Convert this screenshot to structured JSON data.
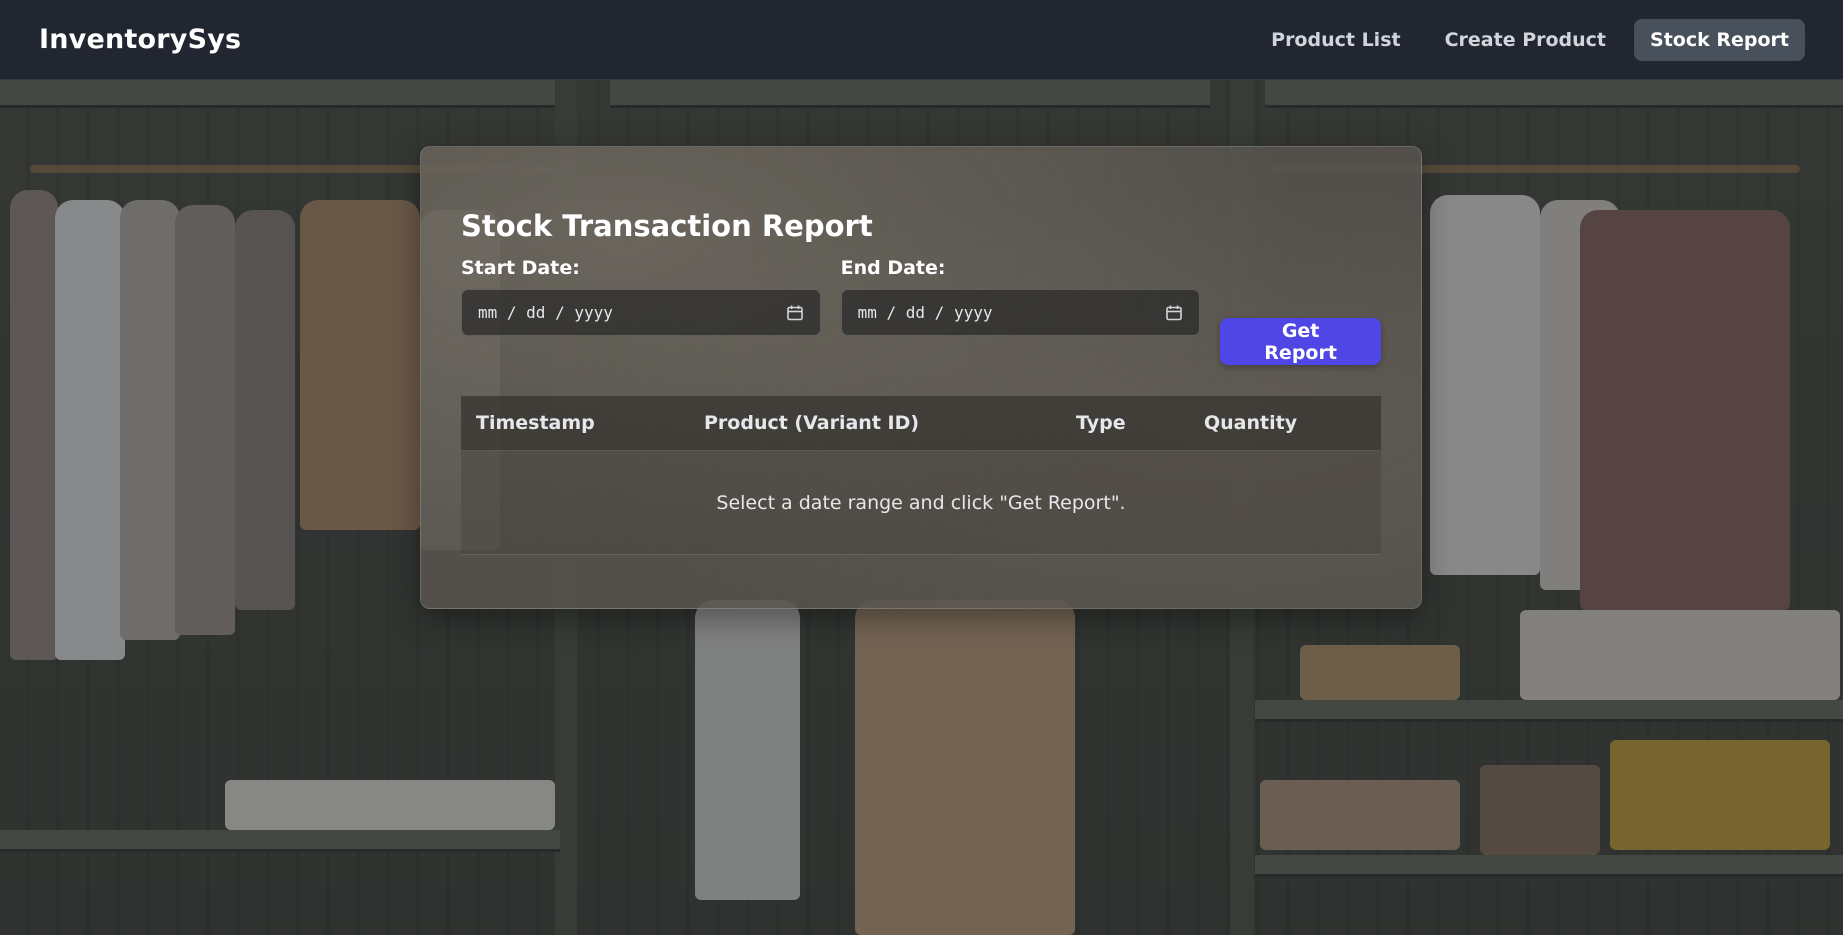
{
  "app": {
    "brand": "InventorySys"
  },
  "nav": {
    "items": [
      {
        "label": "Product List",
        "active": false
      },
      {
        "label": "Create Product",
        "active": false
      },
      {
        "label": "Stock Report",
        "active": true
      }
    ]
  },
  "report": {
    "title": "Stock Transaction Report",
    "start_date": {
      "label": "Start Date:",
      "placeholder": "mm / dd / yyyy",
      "icon": "calendar-icon"
    },
    "end_date": {
      "label": "End Date:",
      "placeholder": "mm / dd / yyyy",
      "icon": "calendar-icon"
    },
    "submit_label": "Get Report",
    "table": {
      "columns": [
        "Timestamp",
        "Product (Variant ID)",
        "Type",
        "Quantity"
      ],
      "rows": [],
      "empty_message": "Select a date range and click \"Get Report\"."
    }
  },
  "colors": {
    "accent": "#4f46e5",
    "navbar": "#1f2530",
    "active_nav": "#4b525e"
  }
}
